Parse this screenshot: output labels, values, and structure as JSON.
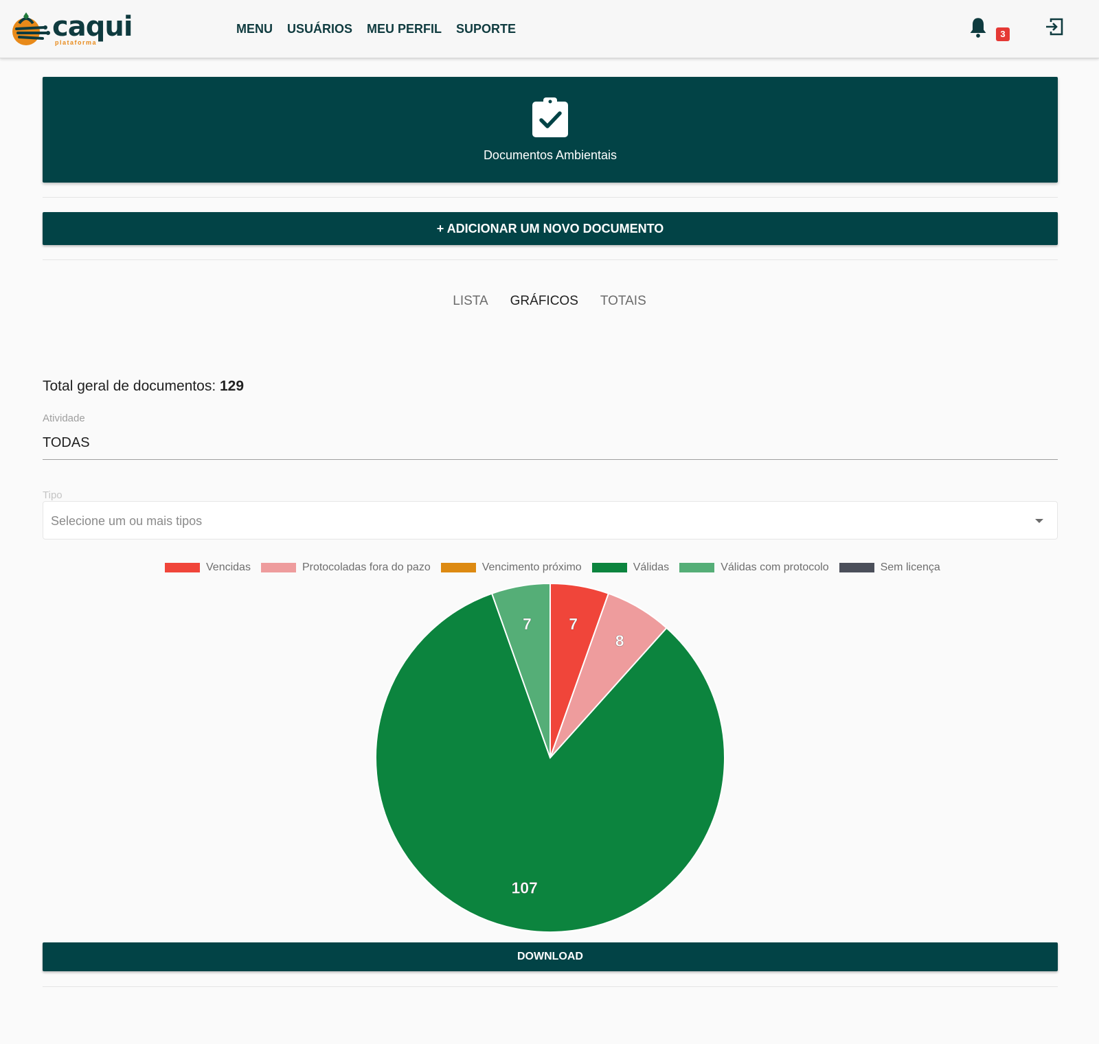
{
  "header": {
    "logo_text": "caqui",
    "logo_sub": "plataforma",
    "nav": [
      "MENU",
      "USUÁRIOS",
      "MEU PERFIL",
      "SUPORTE"
    ],
    "notifications_count": "3",
    "icons": {
      "bell": "bell-icon",
      "logout": "logout-icon"
    }
  },
  "hero": {
    "title": "Documentos Ambientais",
    "icon": "clipboard-check-icon"
  },
  "actions": {
    "add_label": "+ ADICIONAR UM NOVO DOCUMENTO",
    "download_label": "DOWNLOAD"
  },
  "tabs": [
    {
      "label": "LISTA",
      "active": false
    },
    {
      "label": "GRÁFICOS",
      "active": true
    },
    {
      "label": "TOTAIS",
      "active": false
    }
  ],
  "summary": {
    "total_label": "Total geral de documentos:",
    "total_value": "129"
  },
  "filters": {
    "atividade_label": "Atividade",
    "atividade_value": "TODAS",
    "tipo_label": "Tipo",
    "tipo_placeholder": "Selecione um ou mais tipos"
  },
  "colors": {
    "primary": "#024346",
    "badge": "#e53935",
    "logo_accent": "#e88a1a"
  },
  "chart_data": {
    "type": "pie",
    "title": "",
    "legend_position": "top",
    "categories": [
      "Vencidas",
      "Protocoladas fora do pazo",
      "Vencimento próximo",
      "Válidas",
      "Válidas com protocolo",
      "Sem licença"
    ],
    "values": [
      7,
      8,
      0,
      107,
      7,
      0
    ],
    "colors": [
      "#f0453a",
      "#ee9c9d",
      "#dd8a12",
      "#0c843e",
      "#55ae77",
      "#4b4f5a"
    ],
    "data_labels": [
      "7",
      "8",
      "",
      "107",
      "7",
      ""
    ]
  }
}
